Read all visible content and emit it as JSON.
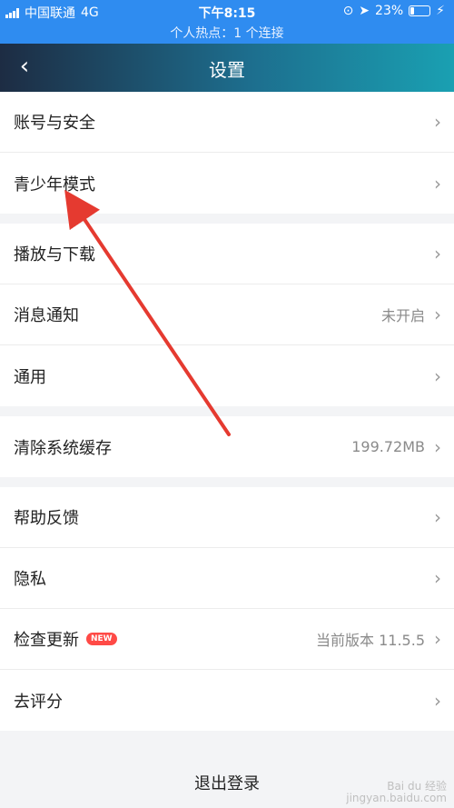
{
  "status_bar": {
    "carrier": "中国联通",
    "network": "4G",
    "time": "下午8:15",
    "battery_percent": "23%",
    "hotspot": "个人热点：1 个连接",
    "color": "#2f8cf0"
  },
  "nav": {
    "title": "设置"
  },
  "groups": [
    [
      {
        "label": "账号与安全",
        "value": ""
      },
      {
        "label": "青少年模式",
        "value": ""
      }
    ],
    [
      {
        "label": "播放与下载",
        "value": ""
      },
      {
        "label": "消息通知",
        "value": "未开启"
      },
      {
        "label": "通用",
        "value": ""
      }
    ],
    [
      {
        "label": "清除系统缓存",
        "value": "199.72MB"
      }
    ],
    [
      {
        "label": "帮助反馈",
        "value": ""
      },
      {
        "label": "隐私",
        "value": ""
      },
      {
        "label": "检查更新",
        "value": "当前版本 11.5.5",
        "badge": "NEW"
      },
      {
        "label": "去评分",
        "value": ""
      }
    ]
  ],
  "logout_label": "退出登录",
  "annotation": {
    "type": "arrow",
    "color": "#e53a30",
    "target": "青少年模式"
  },
  "watermark": {
    "line1": "Bai du 经验",
    "line2": "jingyan.baidu.com"
  }
}
